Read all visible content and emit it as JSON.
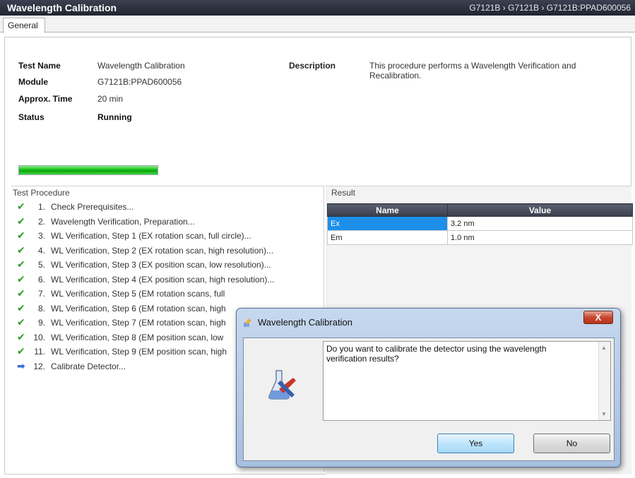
{
  "window": {
    "title": "Wavelength Calibration",
    "breadcrumb": "G7121B › G7121B › G7121B:PPAD600056"
  },
  "tabs": [
    {
      "label": "General"
    }
  ],
  "info": {
    "test_name_label": "Test Name",
    "test_name_value": "Wavelength Calibration",
    "module_label": "Module",
    "module_value": "G7121B:PPAD600056",
    "time_label": "Approx. Time",
    "time_value": "20 min",
    "status_label": "Status",
    "status_value": "Running",
    "description_label": "Description",
    "description_value": "This procedure performs a Wavelength Verification and Recalibration."
  },
  "progress": {
    "percent": 100,
    "color": "#18c018"
  },
  "procedure": {
    "title": "Test Procedure",
    "steps": [
      {
        "num": "1.",
        "text": "Check Prerequisites...",
        "state": "done",
        "icon": "check-icon"
      },
      {
        "num": "2.",
        "text": "Wavelength Verification, Preparation...",
        "state": "done",
        "icon": "check-icon"
      },
      {
        "num": "3.",
        "text": "WL Verification, Step 1 (EX rotation scan, full circle)...",
        "state": "done",
        "icon": "check-icon"
      },
      {
        "num": "4.",
        "text": "WL Verification, Step 2 (EX rotation scan, high resolution)...",
        "state": "done",
        "icon": "check-icon"
      },
      {
        "num": "5.",
        "text": "WL Verification, Step 3 (EX position scan, low resolution)...",
        "state": "done",
        "icon": "check-icon"
      },
      {
        "num": "6.",
        "text": "WL Verification, Step 4 (EX position scan, high resolution)...",
        "state": "done",
        "icon": "check-icon"
      },
      {
        "num": "7.",
        "text": "WL Verification, Step 5 (EM rotation scans, full",
        "state": "done",
        "icon": "check-icon"
      },
      {
        "num": "8.",
        "text": "WL Verification, Step 6 (EM rotation scan, high",
        "state": "done",
        "icon": "check-icon"
      },
      {
        "num": "9.",
        "text": "WL Verification, Step 7 (EM rotation scan, high",
        "state": "done",
        "icon": "check-icon"
      },
      {
        "num": "10.",
        "text": "WL Verification, Step 8 (EM position scan, low",
        "state": "done",
        "icon": "check-icon"
      },
      {
        "num": "11.",
        "text": "WL Verification, Step 9 (EM position scan, high",
        "state": "done",
        "icon": "check-icon"
      },
      {
        "num": "12.",
        "text": "Calibrate Detector...",
        "state": "current",
        "icon": "arrow-right-icon"
      }
    ]
  },
  "result": {
    "title": "Result",
    "columns": [
      "Name",
      "Value"
    ],
    "rows": [
      {
        "name": "Ex",
        "value": "3.2 nm"
      },
      {
        "name": "Em",
        "value": "1.0 nm"
      }
    ]
  },
  "dialog": {
    "title": "Wavelength Calibration",
    "close_label": "X",
    "message": "Do you want to calibrate the detector using the wavelength verification results?",
    "yes_label": "Yes",
    "no_label": "No"
  },
  "colors": {
    "titlebar": "#1f2430",
    "check": "#2f9a28",
    "current_arrow": "#3a6fd6",
    "selected_cell": "#1e8fe8",
    "close_button": "#c7472f"
  }
}
